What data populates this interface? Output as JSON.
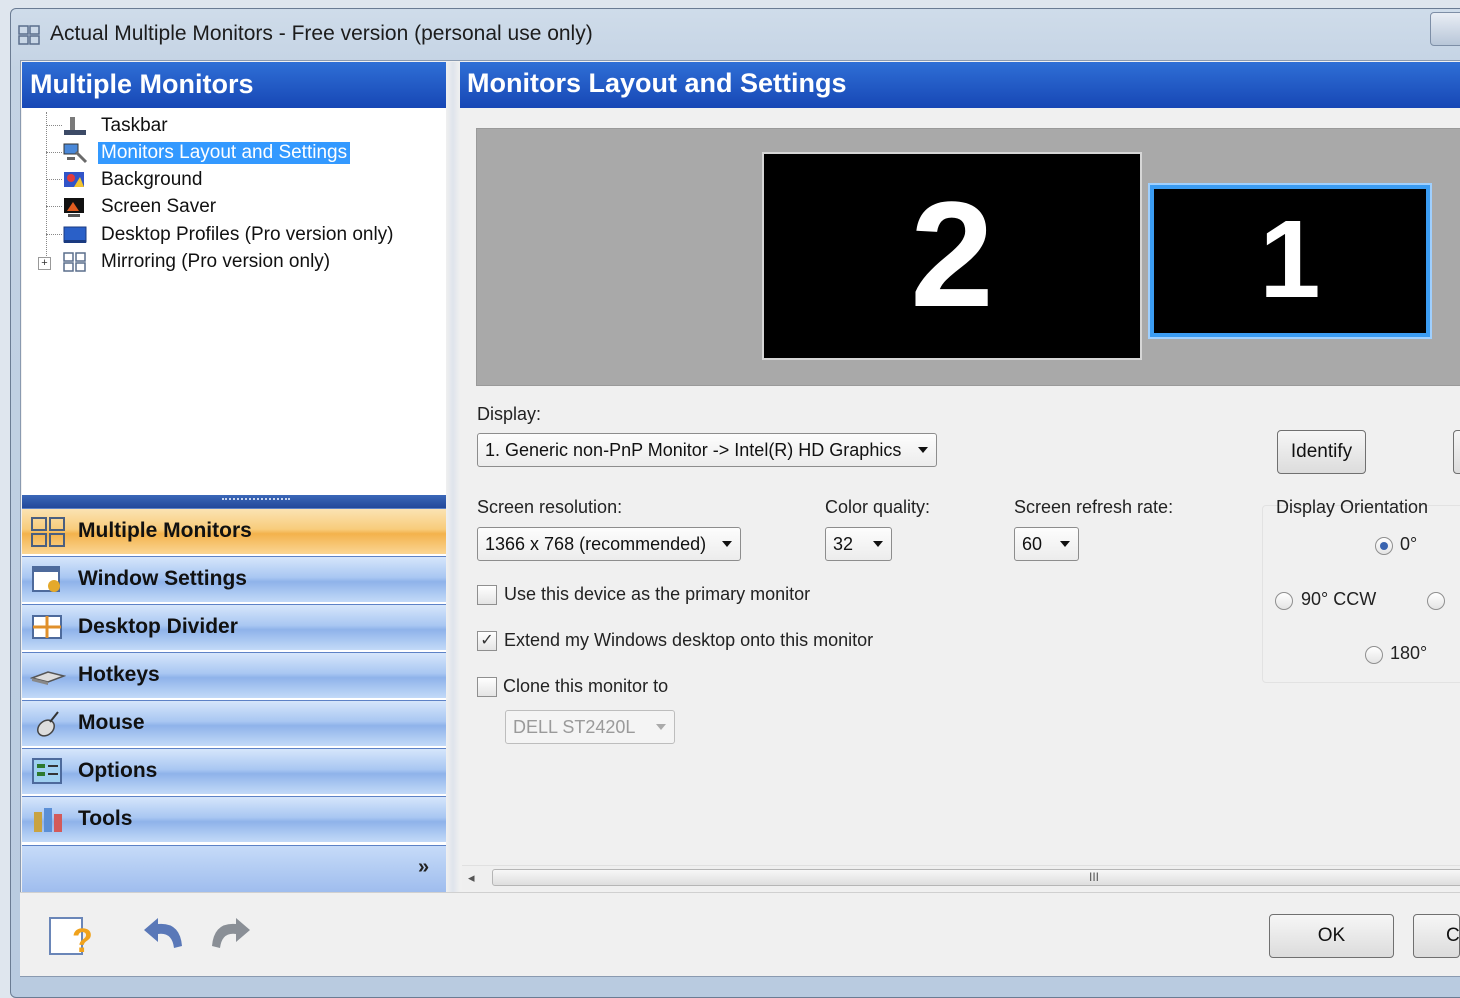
{
  "window": {
    "title": "Actual Multiple Monitors - Free version (personal use only)"
  },
  "left_pane": {
    "header": "Multiple Monitors",
    "tree": [
      {
        "label": "Taskbar",
        "icon": "taskbar-icon"
      },
      {
        "label": "Monitors Layout and Settings",
        "icon": "monitors-settings-icon",
        "selected": true
      },
      {
        "label": "Background",
        "icon": "background-icon"
      },
      {
        "label": "Screen Saver",
        "icon": "screen-saver-icon"
      },
      {
        "label": "Desktop Profiles (Pro version only)",
        "icon": "desktop-profiles-icon"
      },
      {
        "label": "Mirroring (Pro version only)",
        "icon": "mirroring-icon",
        "expandable": true
      }
    ],
    "nav": [
      {
        "label": "Multiple Monitors",
        "icon": "multiple-monitors-icon",
        "active": true
      },
      {
        "label": "Window Settings",
        "icon": "window-settings-icon"
      },
      {
        "label": "Desktop Divider",
        "icon": "desktop-divider-icon"
      },
      {
        "label": "Hotkeys",
        "icon": "keyboard-icon"
      },
      {
        "label": "Mouse",
        "icon": "mouse-icon"
      },
      {
        "label": "Options",
        "icon": "options-icon"
      },
      {
        "label": "Tools",
        "icon": "tools-icon"
      }
    ]
  },
  "right_pane": {
    "header": "Monitors Layout and Settings",
    "monitors": {
      "left_number": "2",
      "right_number": "1",
      "selected": "1"
    },
    "display": {
      "label": "Display:",
      "value": "1. Generic non-PnP Monitor -> Intel(R) HD Graphics",
      "identify_label": "Identify"
    },
    "resolution": {
      "label": "Screen resolution:",
      "value": "1366 x 768 (recommended)"
    },
    "color_quality": {
      "label": "Color quality:",
      "value": "32"
    },
    "refresh_rate": {
      "label": "Screen refresh rate:",
      "value": "60"
    },
    "orientation": {
      "label": "Display Orientation",
      "options": [
        "0°",
        "90° CCW",
        "180°"
      ],
      "selected": "0°"
    },
    "checkboxes": {
      "primary": {
        "label": "Use this device as the primary monitor",
        "checked": false
      },
      "extend": {
        "label": "Extend my Windows desktop onto this monitor",
        "checked": true
      },
      "clone": {
        "label": "Clone this monitor to",
        "checked": false
      }
    },
    "clone_target": {
      "value": "DELL ST2420L"
    },
    "scrollbar_grip": "III"
  },
  "buttons": {
    "ok": "OK",
    "cancel_partial": "C"
  },
  "colors": {
    "header_blue": "#1f56c4",
    "selection": "#3399ff",
    "active_nav": "#f5b955",
    "monitor_highlight": "#3b9cf2"
  }
}
